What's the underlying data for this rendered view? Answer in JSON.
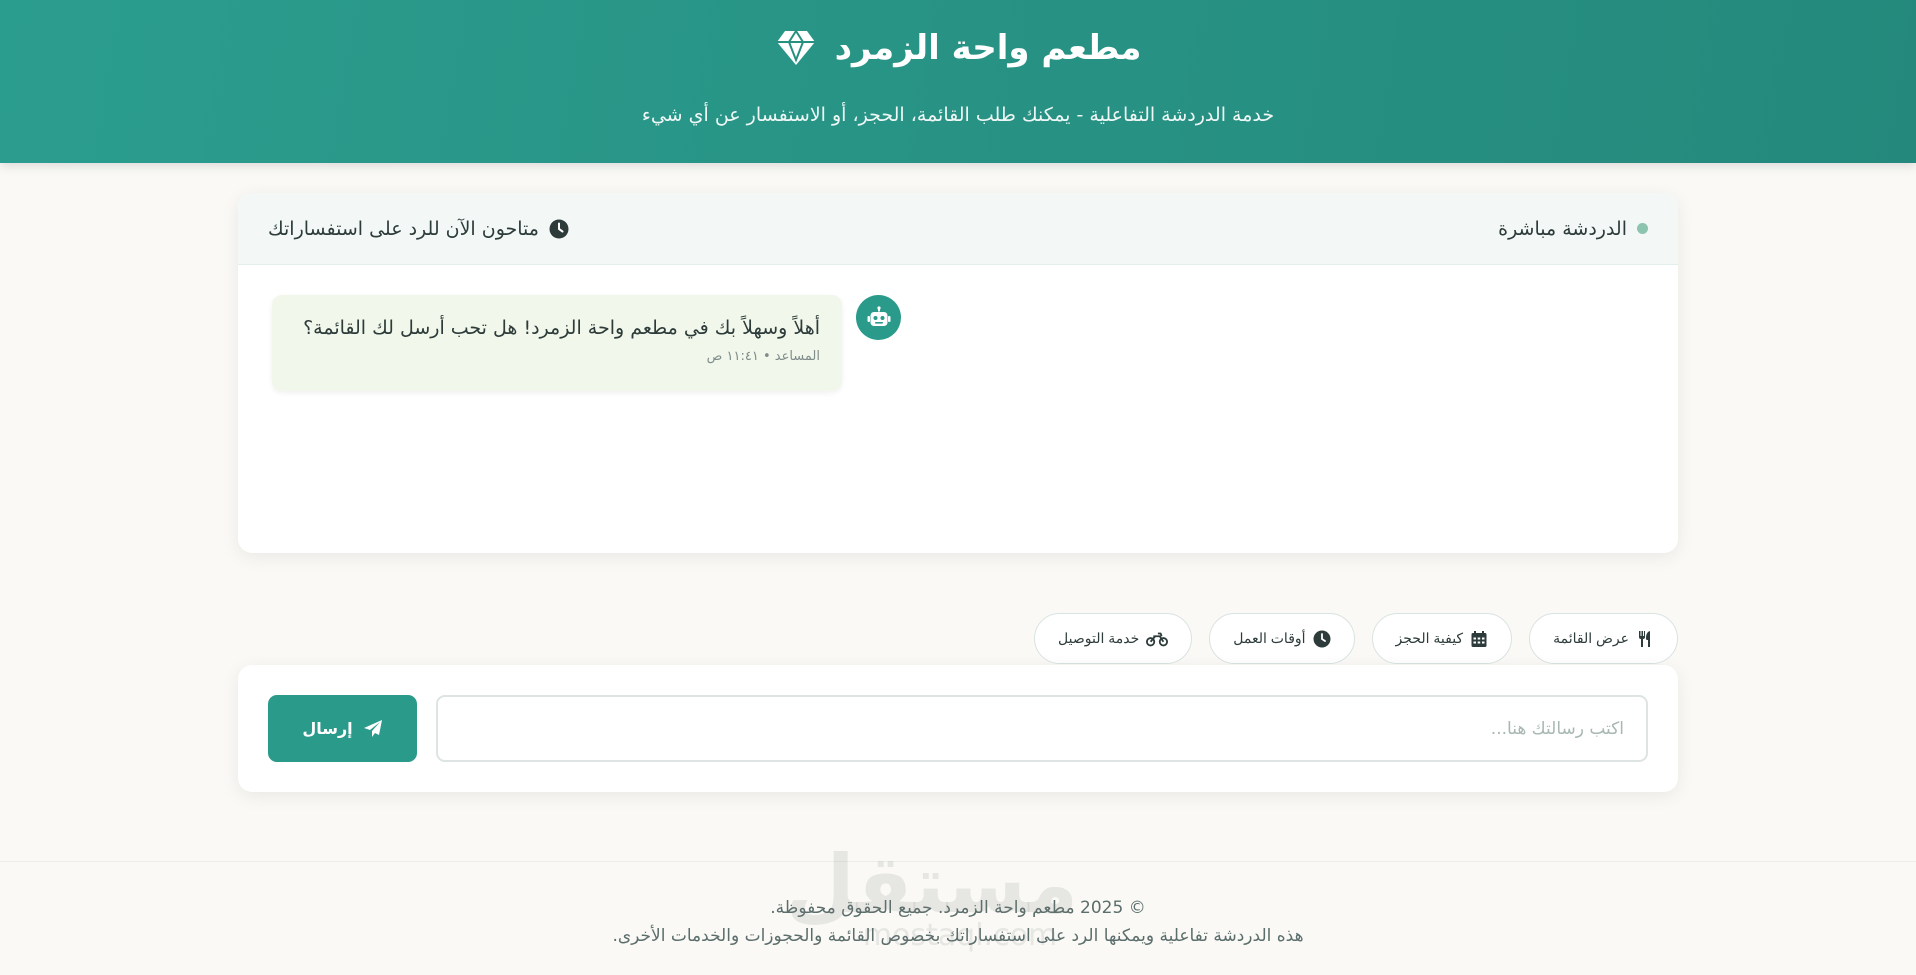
{
  "header": {
    "title": "مطعم واحة الزمرد",
    "subtitle": "خدمة الدردشة التفاعلية - يمكنك طلب القائمة، الحجز، أو الاستفسار عن أي شيء",
    "logo_icon": "gem-icon"
  },
  "chat": {
    "status_label": "الدردشة مباشرة",
    "availability_label": "متاحون الآن للرد على استفساراتك",
    "messages": [
      {
        "text": "أهلاً وسهلاً بك في مطعم واحة الزمرد! هل تحب أرسل لك القائمة؟",
        "meta": "المساعد • ١١:٤١ ص",
        "sender_icon": "robot-icon"
      }
    ]
  },
  "quick_actions": [
    {
      "label": "عرض القائمة",
      "icon": "utensils-icon"
    },
    {
      "label": "كيفية الحجز",
      "icon": "calendar-icon"
    },
    {
      "label": "أوقات العمل",
      "icon": "clock-icon"
    },
    {
      "label": "خدمة التوصيل",
      "icon": "motorcycle-icon"
    }
  ],
  "composer": {
    "placeholder": "اكتب رسالتك هنا...",
    "send_label": "إرسال",
    "send_icon": "paper-plane-icon"
  },
  "footer": {
    "copyright": "© 2025 مطعم واحة الزمرد. جميع الحقوق محفوظة.",
    "note": "هذه الدردشة تفاعلية ويمكنها الرد على استفساراتك بخصوص القائمة والحجوزات والخدمات الأخرى."
  },
  "watermark": {
    "text": "مستقل",
    "sub": "mostaql.com"
  },
  "colors": {
    "primary": "#2a9a8b",
    "header_gradient_start": "#2b9d8e",
    "header_gradient_end": "#24897c",
    "bubble_bg": "#f1f7ea",
    "status_dot": "#8cc4b0"
  }
}
